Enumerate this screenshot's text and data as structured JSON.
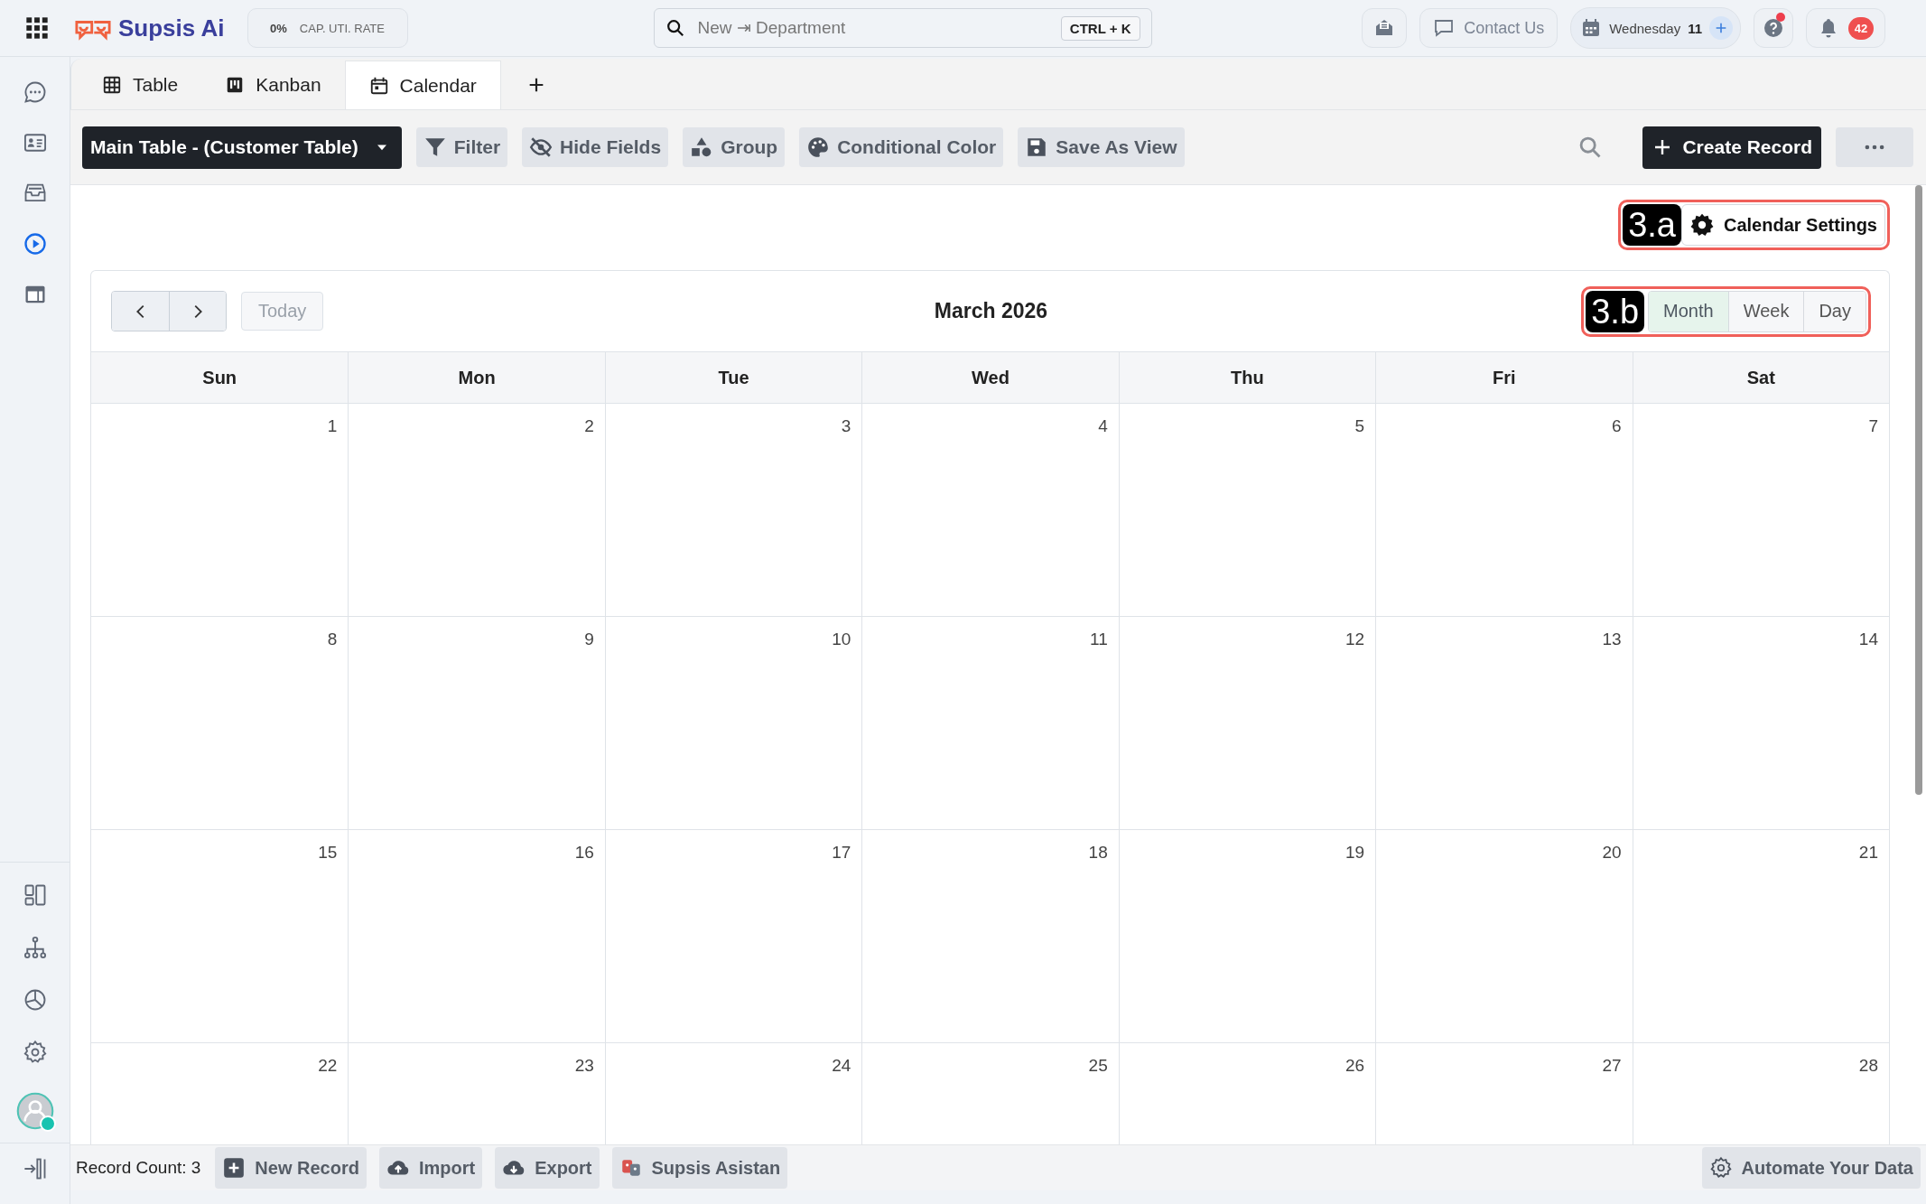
{
  "top_bar": {
    "logo": "Supsis Ai",
    "utilization": {
      "value": "0%",
      "label": "CAP. UTI. RATE"
    },
    "search": {
      "placeholder": "New ⇥ Department",
      "shortcut": "CTRL + K"
    },
    "contact": "Contact Us",
    "date": {
      "weekday": "Wednesday",
      "day": "11"
    },
    "help_alert": true,
    "notifications": "42"
  },
  "sidebar": {
    "top_items": [
      {
        "kind": "chat",
        "selected": false
      },
      {
        "kind": "card",
        "selected": false
      },
      {
        "kind": "inbox",
        "selected": false
      },
      {
        "kind": "play",
        "selected": true
      },
      {
        "kind": "window",
        "selected": false
      }
    ],
    "bottom_items": [
      {
        "kind": "layout",
        "selected": false
      },
      {
        "kind": "tree",
        "selected": false
      },
      {
        "kind": "pie",
        "selected": false
      },
      {
        "kind": "gear",
        "selected": false
      }
    ],
    "user_online": true
  },
  "tabs": [
    {
      "label": "Table",
      "kind": "table",
      "selected": false
    },
    {
      "label": "Kanban",
      "kind": "kanban",
      "selected": false
    },
    {
      "label": "Calendar",
      "kind": "calendar",
      "selected": true
    }
  ],
  "toolbar": {
    "table_select": "Main Table - (Customer Table)",
    "buttons": [
      {
        "label": "Filter",
        "kind": "filter"
      },
      {
        "label": "Hide Fields",
        "kind": "hide"
      },
      {
        "label": "Group",
        "kind": "group"
      },
      {
        "label": "Conditional Color",
        "kind": "palette"
      },
      {
        "label": "Save As View",
        "kind": "save"
      }
    ],
    "create": "Create Record"
  },
  "calendar_settings": {
    "badge": "3.a",
    "label": "Calendar Settings"
  },
  "calendar": {
    "title": "March 2026",
    "today": {
      "label": "Today",
      "disabled": true
    },
    "views_badge": "3.b",
    "views": [
      {
        "label": "Month",
        "selected": true
      },
      {
        "label": "Week",
        "selected": false
      },
      {
        "label": "Day",
        "selected": false
      }
    ],
    "weekdays": [
      "Sun",
      "Mon",
      "Tue",
      "Wed",
      "Thu",
      "Fri",
      "Sat"
    ],
    "weeks": [
      [
        "1",
        "2",
        "3",
        "4",
        "5",
        "6",
        "7"
      ],
      [
        "8",
        "9",
        "10",
        "11",
        "12",
        "13",
        "14"
      ],
      [
        "15",
        "16",
        "17",
        "18",
        "19",
        "20",
        "21"
      ],
      [
        "22",
        "23",
        "24",
        "25",
        "26",
        "27",
        "28"
      ]
    ]
  },
  "footer": {
    "record_count": "Record Count: 3",
    "buttons": [
      {
        "label": "New Record",
        "kind": "plus"
      },
      {
        "label": "Import",
        "kind": "upload"
      },
      {
        "label": "Export",
        "kind": "download"
      },
      {
        "label": "Supsis Asistan",
        "kind": "assistant"
      }
    ],
    "automate": "Automate Your Data"
  }
}
